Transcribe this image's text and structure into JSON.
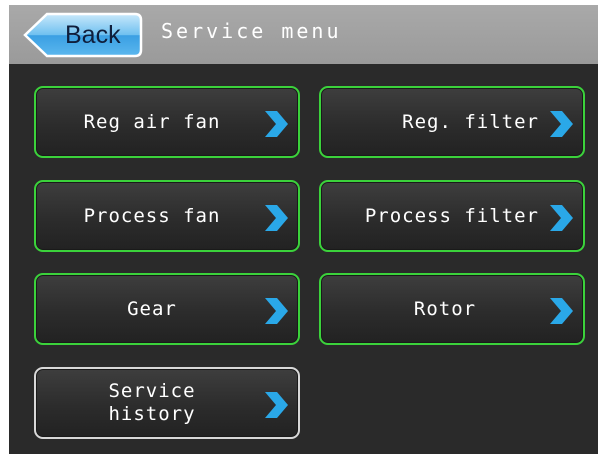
{
  "header": {
    "back_label": "Back",
    "title": "Service menu",
    "bar_color": "#a0a0a0",
    "back_color": "#3aa0e8"
  },
  "menu": {
    "accent_border": "#3bd23b",
    "chevron_color": "#2aa8e8",
    "items": [
      {
        "label": "Reg air fan",
        "icon": "chevron-right-icon"
      },
      {
        "label": "Reg. filter",
        "icon": "chevron-right-icon"
      },
      {
        "label": "Process fan",
        "icon": "chevron-right-icon"
      },
      {
        "label": "Process filter",
        "icon": "chevron-right-icon"
      },
      {
        "label": "Gear",
        "icon": "chevron-right-icon"
      },
      {
        "label": "Rotor",
        "icon": "chevron-right-icon"
      },
      {
        "label": "Service\nhistory",
        "icon": "chevron-right-icon"
      }
    ]
  }
}
